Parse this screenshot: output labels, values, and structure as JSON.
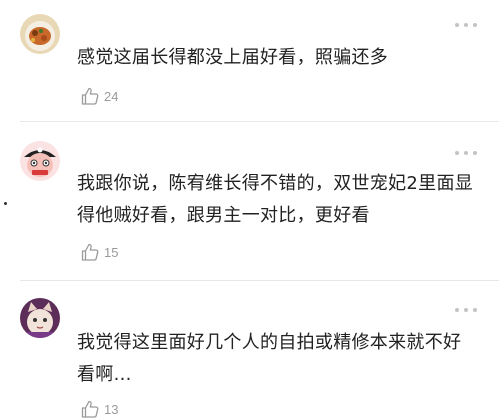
{
  "comments": [
    {
      "avatar_icon": "food-dish-avatar",
      "text": "感觉这届长得都没上届好看，照骗还多",
      "likes": "24"
    },
    {
      "avatar_icon": "pirate-skull-avatar",
      "text": "我跟你说，陈宥维长得不错的，双世宠妃2里面显得他贼好看，跟男主一对比，更好看",
      "likes": "15"
    },
    {
      "avatar_icon": "cat-face-avatar",
      "text": "我觉得这里面好几个人的自拍或精修本来就不好看啊...",
      "likes": "13"
    }
  ],
  "icons": {
    "more": "more-dots-icon",
    "like": "thumbs-up-icon"
  },
  "colors": {
    "text": "#222222",
    "meta": "#9a9a9a",
    "divider": "#e8e8e8"
  }
}
